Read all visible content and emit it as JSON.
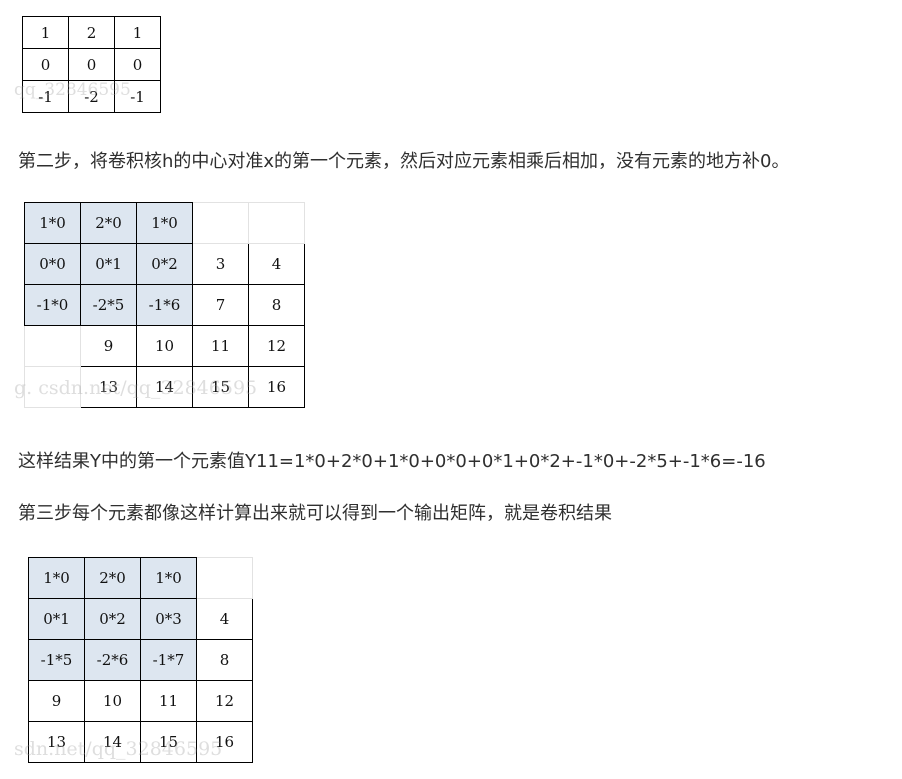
{
  "kernel": [
    [
      "1",
      "2",
      "1"
    ],
    [
      "0",
      "0",
      "0"
    ],
    [
      "-1",
      "-2",
      "-1"
    ]
  ],
  "step2_text": "第二步，将卷积核h的中心对准x的第一个元素，然后对应元素相乘后相加，没有元素的地方补0。",
  "grid1": [
    [
      {
        "t": "1*0",
        "s": "hl"
      },
      {
        "t": "2*0",
        "s": "hl"
      },
      {
        "t": "1*0",
        "s": "hl"
      },
      {
        "t": "",
        "s": "blank"
      },
      {
        "t": "",
        "s": "blank"
      }
    ],
    [
      {
        "t": "0*0",
        "s": "hl"
      },
      {
        "t": "0*1",
        "s": "hl"
      },
      {
        "t": "0*2",
        "s": "hl"
      },
      {
        "t": "3",
        "s": "num"
      },
      {
        "t": "4",
        "s": "num"
      }
    ],
    [
      {
        "t": "-1*0",
        "s": "hl"
      },
      {
        "t": "-2*5",
        "s": "hl"
      },
      {
        "t": "-1*6",
        "s": "hl"
      },
      {
        "t": "7",
        "s": "num"
      },
      {
        "t": "8",
        "s": "num"
      }
    ],
    [
      {
        "t": "",
        "s": "blank"
      },
      {
        "t": "9",
        "s": "num"
      },
      {
        "t": "10",
        "s": "num"
      },
      {
        "t": "11",
        "s": "num"
      },
      {
        "t": "12",
        "s": "num"
      }
    ],
    [
      {
        "t": "",
        "s": "blank"
      },
      {
        "t": "13",
        "s": "num"
      },
      {
        "t": "14",
        "s": "num"
      },
      {
        "t": "15",
        "s": "num"
      },
      {
        "t": "16",
        "s": "num"
      }
    ]
  ],
  "result_text": "这样结果Y中的第一个元素值Y11=1*0+2*0+1*0+0*0+0*1+0*2+-1*0+-2*5+-1*6=-16",
  "step3_text": "第三步每个元素都像这样计算出来就可以得到一个输出矩阵，就是卷积结果",
  "grid2": [
    [
      {
        "t": "1*0",
        "s": "hl"
      },
      {
        "t": "2*0",
        "s": "hl"
      },
      {
        "t": "1*0",
        "s": "hl"
      },
      {
        "t": "",
        "s": "blank"
      }
    ],
    [
      {
        "t": "0*1",
        "s": "hl"
      },
      {
        "t": "0*2",
        "s": "hl"
      },
      {
        "t": "0*3",
        "s": "hl"
      },
      {
        "t": "4",
        "s": "num"
      }
    ],
    [
      {
        "t": "-1*5",
        "s": "hl"
      },
      {
        "t": "-2*6",
        "s": "hl"
      },
      {
        "t": "-1*7",
        "s": "hl"
      },
      {
        "t": "8",
        "s": "num"
      }
    ],
    [
      {
        "t": "9",
        "s": "num"
      },
      {
        "t": "10",
        "s": "num"
      },
      {
        "t": "11",
        "s": "num"
      },
      {
        "t": "12",
        "s": "num"
      }
    ],
    [
      {
        "t": "13",
        "s": "num"
      },
      {
        "t": "14",
        "s": "num"
      },
      {
        "t": "15",
        "s": "num"
      },
      {
        "t": "16",
        "s": "num"
      }
    ]
  ],
  "watermarks": {
    "w1": "qq_32846595",
    "w2": "g. csdn.net/qq_32846595",
    "w3": "sdn.net/qq_32846595"
  }
}
